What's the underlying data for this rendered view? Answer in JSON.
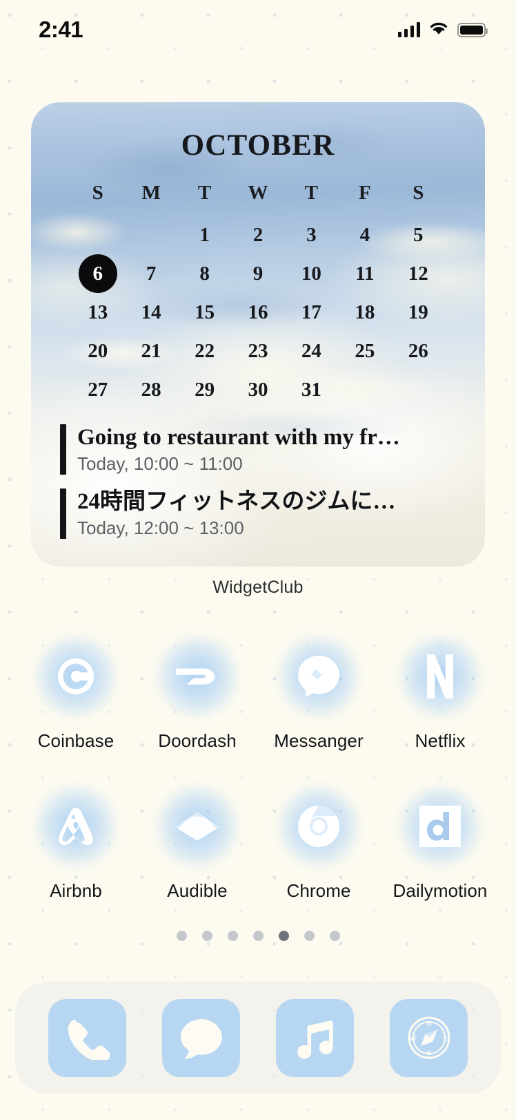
{
  "status_bar": {
    "time": "2:41",
    "signal_icon": "cellular-signal-icon",
    "wifi_icon": "wifi-icon",
    "battery_icon": "battery-icon"
  },
  "widget": {
    "label": "WidgetClub",
    "calendar": {
      "month": "OCTOBER",
      "weekday_headers": [
        "S",
        "M",
        "T",
        "W",
        "T",
        "F",
        "S"
      ],
      "leading_blanks": 2,
      "days": [
        1,
        2,
        3,
        4,
        5,
        6,
        7,
        8,
        9,
        10,
        11,
        12,
        13,
        14,
        15,
        16,
        17,
        18,
        19,
        20,
        21,
        22,
        23,
        24,
        25,
        26,
        27,
        28,
        29,
        30,
        31
      ],
      "today": 6
    },
    "events": [
      {
        "title": "Going to restaurant with my fr…",
        "time": "Today, 10:00 ~ 11:00",
        "accent": "#141417"
      },
      {
        "title": "24時間フィットネスのジムに…",
        "time": "Today, 12:00 ~ 13:00",
        "accent": "#141417"
      }
    ]
  },
  "app_rows": [
    [
      {
        "label": "Coinbase",
        "icon": "coinbase-icon"
      },
      {
        "label": "Doordash",
        "icon": "doordash-icon"
      },
      {
        "label": "Messanger",
        "icon": "messenger-icon"
      },
      {
        "label": "Netflix",
        "icon": "netflix-icon"
      }
    ],
    [
      {
        "label": "Airbnb",
        "icon": "airbnb-icon"
      },
      {
        "label": "Audible",
        "icon": "audible-icon"
      },
      {
        "label": "Chrome",
        "icon": "chrome-icon"
      },
      {
        "label": "Dailymotion",
        "icon": "dailymotion-icon"
      }
    ]
  ],
  "page_dots": {
    "count": 7,
    "active_index": 4
  },
  "dock": [
    {
      "label": "Phone",
      "icon": "phone-icon"
    },
    {
      "label": "Messages",
      "icon": "messages-icon"
    },
    {
      "label": "Music",
      "icon": "music-icon"
    },
    {
      "label": "Compass",
      "icon": "compass-icon"
    }
  ],
  "colors": {
    "background": "#fdfbf0",
    "dock_tile": "#b6d6f2",
    "glow": "#87bef5",
    "today_circle": "#0b0b0d",
    "dot_inactive": "#c4c8cd",
    "dot_active": "#6e7378"
  }
}
